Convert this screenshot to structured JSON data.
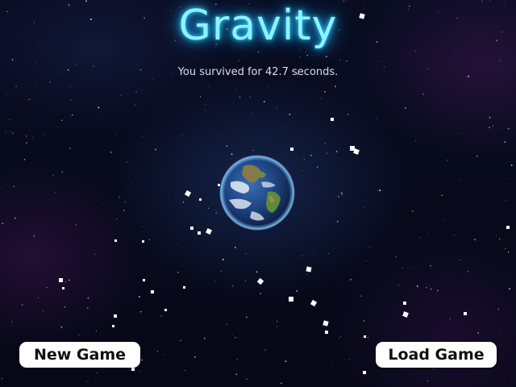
{
  "game": {
    "title": "Gravity",
    "result_text": "You survived for 42.7 seconds."
  },
  "planet": {
    "icon": "earth-icon"
  },
  "buttons": {
    "new_game": "New Game",
    "load_game": "Load Game"
  },
  "colors": {
    "title_glow": "#8ef2ff",
    "button_bg": "#ffffff",
    "background": "#070a18"
  }
}
